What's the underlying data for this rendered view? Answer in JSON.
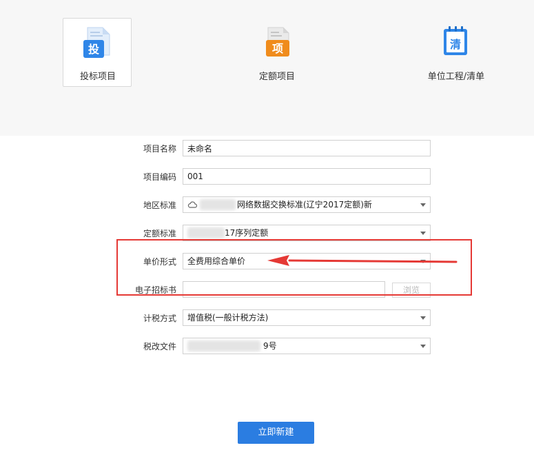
{
  "project_types": [
    {
      "label": "投标项目",
      "icon_glyph": "投",
      "icon": "document-bid-icon",
      "selected": true,
      "accent": "#2f86e8"
    },
    {
      "label": "定额项目",
      "icon_glyph": "项",
      "icon": "document-quota-icon",
      "selected": false,
      "accent": "#f08c1c"
    },
    {
      "label": "单位工程/清单",
      "icon_glyph": "清",
      "icon": "notebook-list-icon",
      "selected": false,
      "accent": "#2f86e8"
    }
  ],
  "form": {
    "project_name": {
      "label": "项目名称",
      "value": "未命名"
    },
    "project_code": {
      "label": "项目编码",
      "value": "001"
    },
    "region_standard": {
      "label": "地区标准",
      "value": "网络数据交换标准(辽宁2017定额)新"
    },
    "quota_standard": {
      "label": "定额标准",
      "value": "17序列定额"
    },
    "unit_price_form": {
      "label": "单价形式",
      "value": "全费用综合单价"
    },
    "e_tender_doc": {
      "label": "电子招标书",
      "value": "",
      "browse_label": "浏览"
    },
    "tax_method": {
      "label": "计税方式",
      "value": "增值税(一般计税方法)"
    },
    "tax_reform_file": {
      "label": "税改文件",
      "value": "9号"
    }
  },
  "actions": {
    "create_label": "立即新建"
  },
  "colors": {
    "primary_button": "#2b7de1",
    "annotation_red": "#e53935",
    "top_band": "#f7f7f7"
  }
}
